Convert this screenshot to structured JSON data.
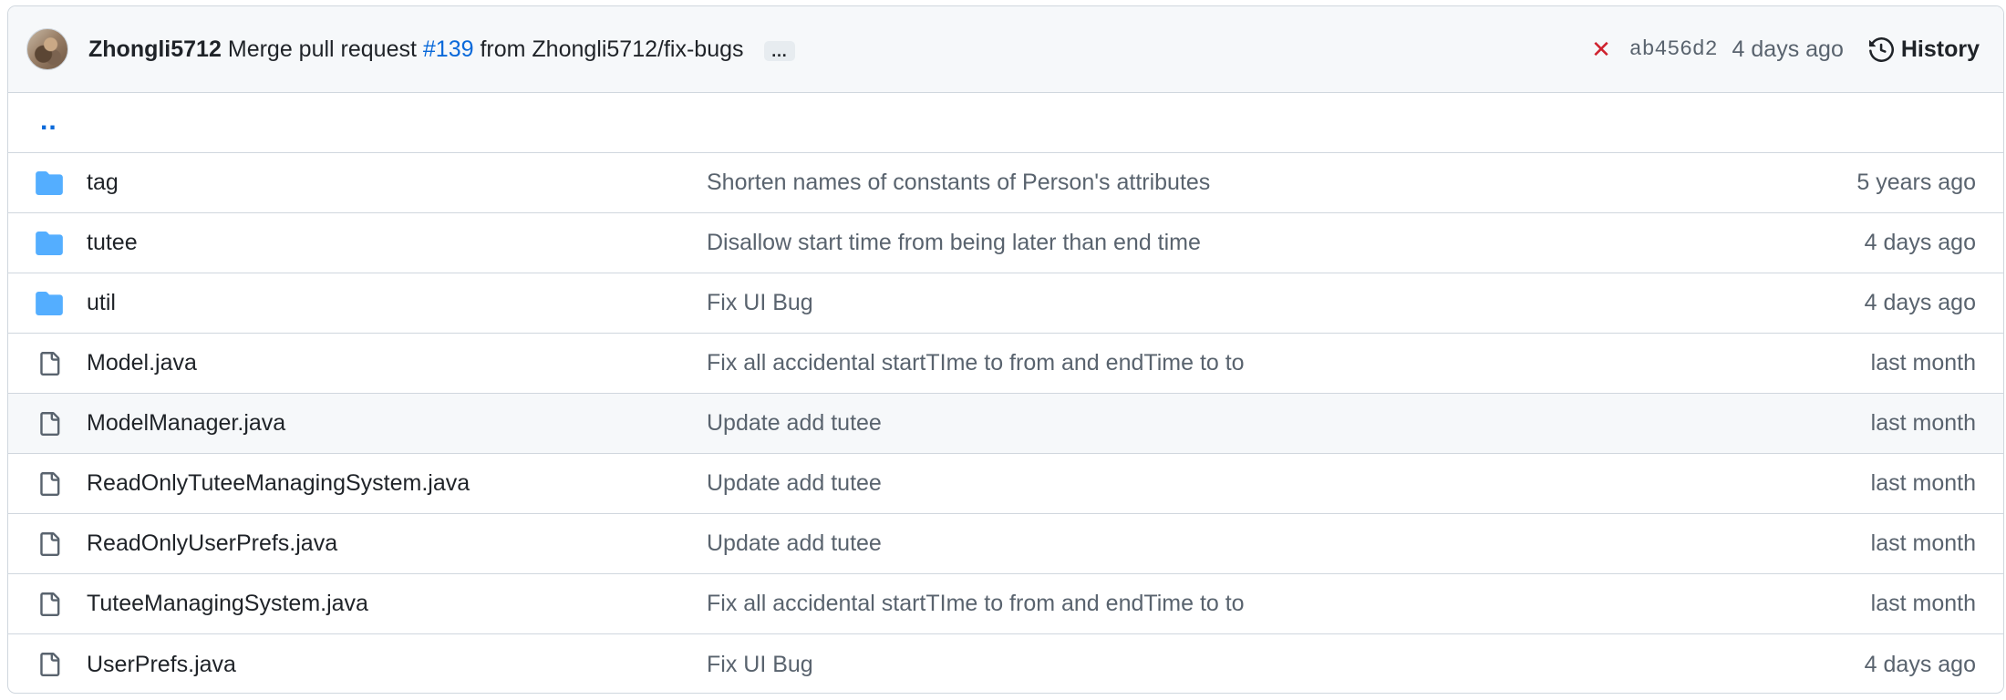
{
  "commit": {
    "author": "Zhongli5712",
    "message_prefix": "Merge pull request ",
    "pr_number": "#139",
    "message_suffix": " from Zhongli5712/fix-bugs",
    "expand_label": "…",
    "status": "✕",
    "status_color": "#cf222e",
    "sha": "ab456d2",
    "time": "4 days ago",
    "history_label": "History"
  },
  "parent_link": "..",
  "entries": [
    {
      "type": "folder",
      "name": "tag",
      "message": "Shorten names of constants of Person's attributes",
      "date": "5 years ago"
    },
    {
      "type": "folder",
      "name": "tutee",
      "message": "Disallow start time from being later than end time",
      "date": "4 days ago"
    },
    {
      "type": "folder",
      "name": "util",
      "message": "Fix UI Bug",
      "date": "4 days ago"
    },
    {
      "type": "file",
      "name": "Model.java",
      "message": "Fix all accidental startTIme to from and endTime to to",
      "date": "last month"
    },
    {
      "type": "file",
      "name": "ModelManager.java",
      "message": "Update add tutee",
      "date": "last month"
    },
    {
      "type": "file",
      "name": "ReadOnlyTuteeManagingSystem.java",
      "message": "Update add tutee",
      "date": "last month"
    },
    {
      "type": "file",
      "name": "ReadOnlyUserPrefs.java",
      "message": "Update add tutee",
      "date": "last month"
    },
    {
      "type": "file",
      "name": "TuteeManagingSystem.java",
      "message": "Fix all accidental startTIme to from and endTime to to",
      "date": "last month"
    },
    {
      "type": "file",
      "name": "UserPrefs.java",
      "message": "Fix UI Bug",
      "date": "4 days ago"
    }
  ],
  "colors": {
    "folder_icon": "#54aeff",
    "file_icon": "#59636e",
    "link": "#0969da",
    "border": "#d0d7de",
    "header_bg": "#f6f8fa"
  }
}
